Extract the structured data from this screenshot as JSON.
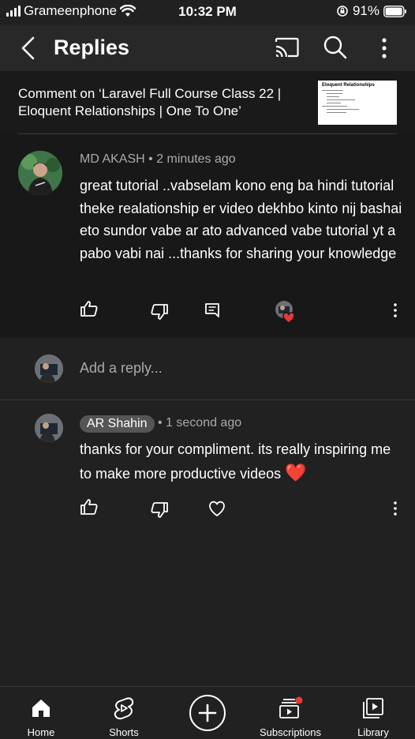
{
  "status_bar": {
    "carrier": "Grameenphone",
    "time": "10:32 PM",
    "battery": "91%"
  },
  "header": {
    "title": "Replies"
  },
  "comment_on": {
    "text": "Comment on ‘Laravel Full Course Class 22 | Eloquent Relationships | One To One’",
    "thumbnail_title": "Eloquent Relationships"
  },
  "main_comment": {
    "author": "MD AKASH",
    "time": "2 minutes ago",
    "body": "great tutorial ..vabselam kono eng ba hindi tutorial theke realationship er video dekhbo kinto nij bashai eto sundor vabe ar ato advanced vabe tutorial yt a pabo vabi nai ...thanks for sharing your knowledge"
  },
  "add_reply": {
    "placeholder": "Add a reply..."
  },
  "reply": {
    "author": "AR Shahin",
    "time": "1 second ago",
    "body": "thanks for your compliment. its really inspiring me to make more productive videos",
    "emoji": "❤️"
  },
  "bottom_nav": {
    "items": [
      {
        "label": "Home",
        "icon": "home-icon"
      },
      {
        "label": "Shorts",
        "icon": "shorts-icon"
      },
      {
        "label": "",
        "icon": "create-icon"
      },
      {
        "label": "Subscriptions",
        "icon": "subscriptions-icon"
      },
      {
        "label": "Library",
        "icon": "library-icon"
      }
    ]
  },
  "colors": {
    "background": "#212121",
    "highlight_background": "#181818",
    "secondary_text": "#aaaaaa",
    "accent_red": "#e53935"
  }
}
